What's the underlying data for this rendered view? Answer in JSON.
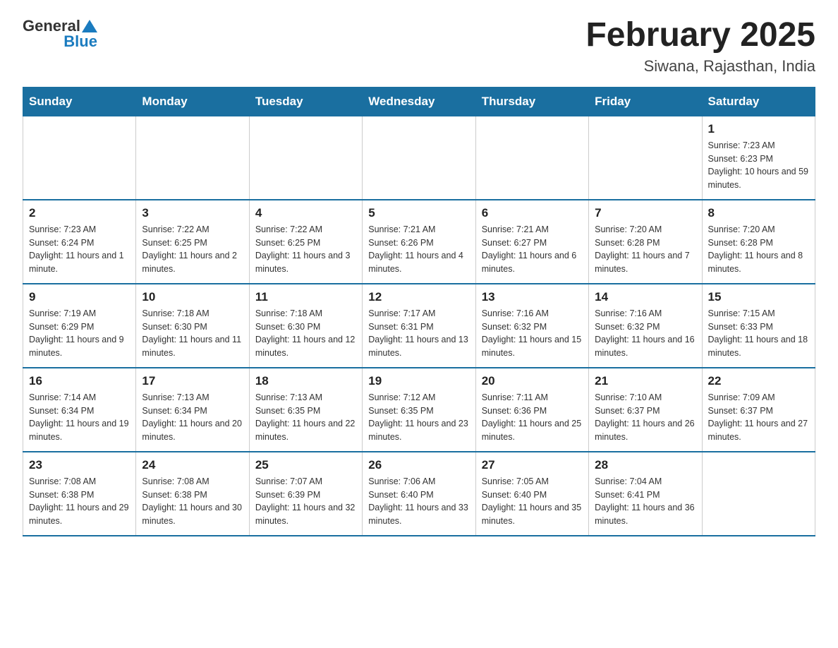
{
  "header": {
    "logo_general": "General",
    "logo_blue": "Blue",
    "title": "February 2025",
    "subtitle": "Siwana, Rajasthan, India"
  },
  "weekdays": [
    "Sunday",
    "Monday",
    "Tuesday",
    "Wednesday",
    "Thursday",
    "Friday",
    "Saturday"
  ],
  "weeks": [
    [
      {
        "day": "",
        "info": ""
      },
      {
        "day": "",
        "info": ""
      },
      {
        "day": "",
        "info": ""
      },
      {
        "day": "",
        "info": ""
      },
      {
        "day": "",
        "info": ""
      },
      {
        "day": "",
        "info": ""
      },
      {
        "day": "1",
        "info": "Sunrise: 7:23 AM\nSunset: 6:23 PM\nDaylight: 10 hours and 59 minutes."
      }
    ],
    [
      {
        "day": "2",
        "info": "Sunrise: 7:23 AM\nSunset: 6:24 PM\nDaylight: 11 hours and 1 minute."
      },
      {
        "day": "3",
        "info": "Sunrise: 7:22 AM\nSunset: 6:25 PM\nDaylight: 11 hours and 2 minutes."
      },
      {
        "day": "4",
        "info": "Sunrise: 7:22 AM\nSunset: 6:25 PM\nDaylight: 11 hours and 3 minutes."
      },
      {
        "day": "5",
        "info": "Sunrise: 7:21 AM\nSunset: 6:26 PM\nDaylight: 11 hours and 4 minutes."
      },
      {
        "day": "6",
        "info": "Sunrise: 7:21 AM\nSunset: 6:27 PM\nDaylight: 11 hours and 6 minutes."
      },
      {
        "day": "7",
        "info": "Sunrise: 7:20 AM\nSunset: 6:28 PM\nDaylight: 11 hours and 7 minutes."
      },
      {
        "day": "8",
        "info": "Sunrise: 7:20 AM\nSunset: 6:28 PM\nDaylight: 11 hours and 8 minutes."
      }
    ],
    [
      {
        "day": "9",
        "info": "Sunrise: 7:19 AM\nSunset: 6:29 PM\nDaylight: 11 hours and 9 minutes."
      },
      {
        "day": "10",
        "info": "Sunrise: 7:18 AM\nSunset: 6:30 PM\nDaylight: 11 hours and 11 minutes."
      },
      {
        "day": "11",
        "info": "Sunrise: 7:18 AM\nSunset: 6:30 PM\nDaylight: 11 hours and 12 minutes."
      },
      {
        "day": "12",
        "info": "Sunrise: 7:17 AM\nSunset: 6:31 PM\nDaylight: 11 hours and 13 minutes."
      },
      {
        "day": "13",
        "info": "Sunrise: 7:16 AM\nSunset: 6:32 PM\nDaylight: 11 hours and 15 minutes."
      },
      {
        "day": "14",
        "info": "Sunrise: 7:16 AM\nSunset: 6:32 PM\nDaylight: 11 hours and 16 minutes."
      },
      {
        "day": "15",
        "info": "Sunrise: 7:15 AM\nSunset: 6:33 PM\nDaylight: 11 hours and 18 minutes."
      }
    ],
    [
      {
        "day": "16",
        "info": "Sunrise: 7:14 AM\nSunset: 6:34 PM\nDaylight: 11 hours and 19 minutes."
      },
      {
        "day": "17",
        "info": "Sunrise: 7:13 AM\nSunset: 6:34 PM\nDaylight: 11 hours and 20 minutes."
      },
      {
        "day": "18",
        "info": "Sunrise: 7:13 AM\nSunset: 6:35 PM\nDaylight: 11 hours and 22 minutes."
      },
      {
        "day": "19",
        "info": "Sunrise: 7:12 AM\nSunset: 6:35 PM\nDaylight: 11 hours and 23 minutes."
      },
      {
        "day": "20",
        "info": "Sunrise: 7:11 AM\nSunset: 6:36 PM\nDaylight: 11 hours and 25 minutes."
      },
      {
        "day": "21",
        "info": "Sunrise: 7:10 AM\nSunset: 6:37 PM\nDaylight: 11 hours and 26 minutes."
      },
      {
        "day": "22",
        "info": "Sunrise: 7:09 AM\nSunset: 6:37 PM\nDaylight: 11 hours and 27 minutes."
      }
    ],
    [
      {
        "day": "23",
        "info": "Sunrise: 7:08 AM\nSunset: 6:38 PM\nDaylight: 11 hours and 29 minutes."
      },
      {
        "day": "24",
        "info": "Sunrise: 7:08 AM\nSunset: 6:38 PM\nDaylight: 11 hours and 30 minutes."
      },
      {
        "day": "25",
        "info": "Sunrise: 7:07 AM\nSunset: 6:39 PM\nDaylight: 11 hours and 32 minutes."
      },
      {
        "day": "26",
        "info": "Sunrise: 7:06 AM\nSunset: 6:40 PM\nDaylight: 11 hours and 33 minutes."
      },
      {
        "day": "27",
        "info": "Sunrise: 7:05 AM\nSunset: 6:40 PM\nDaylight: 11 hours and 35 minutes."
      },
      {
        "day": "28",
        "info": "Sunrise: 7:04 AM\nSunset: 6:41 PM\nDaylight: 11 hours and 36 minutes."
      },
      {
        "day": "",
        "info": ""
      }
    ]
  ]
}
